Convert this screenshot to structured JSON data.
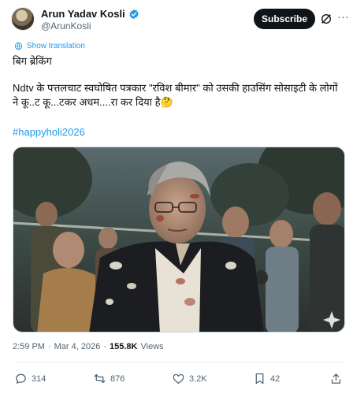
{
  "author": {
    "name": "Arun Yadav Kosli",
    "handle": "@ArunKosli"
  },
  "header": {
    "subscribe_label": "Subscribe",
    "more_label": "···"
  },
  "post": {
    "translate_label": "Show translation",
    "title": "बिग ब्रेकिंग",
    "body": "Ndtv के पत्तलचाट स्वघोषित पत्रकार \"रविश बीमार\" को उसकी हाउसिंग सोसाइटी के लोगों ने कू..ट कू...टकर अधम....रा कर दिया है🤔",
    "hashtag": "#happyholi2026"
  },
  "meta": {
    "time": "2:59 PM",
    "date": "Mar 4, 2026",
    "separator": "·",
    "views_count": "155.8K",
    "views_label": "Views"
  },
  "actions": {
    "replies": "314",
    "reposts": "876",
    "likes": "3.2K",
    "bookmarks": "42"
  },
  "colors": {
    "accent": "#1d9bf0",
    "text": "#0f1419",
    "muted": "#536471"
  },
  "icons": [
    "verified-icon",
    "grok-icon",
    "translate-globe-icon",
    "reply-icon",
    "repost-icon",
    "like-icon",
    "bookmark-icon",
    "share-icon",
    "ai-sparkle-icon"
  ]
}
